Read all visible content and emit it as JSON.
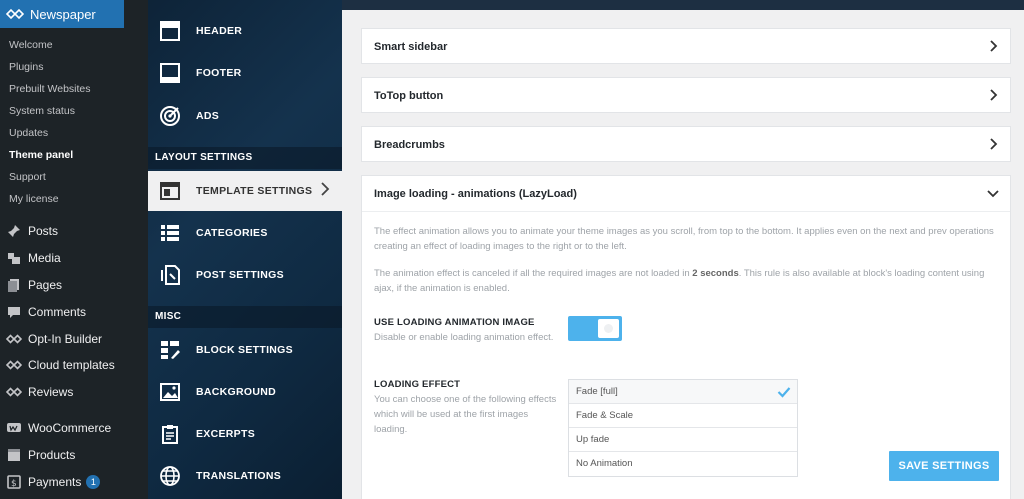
{
  "wp_menu": {
    "brand": "Newspaper",
    "submenu": [
      {
        "label": "Welcome",
        "current": false
      },
      {
        "label": "Plugins",
        "current": false
      },
      {
        "label": "Prebuilt Websites",
        "current": false
      },
      {
        "label": "System status",
        "current": false
      },
      {
        "label": "Updates",
        "current": false
      },
      {
        "label": "Theme panel",
        "current": true
      },
      {
        "label": "Support",
        "current": false
      },
      {
        "label": "My license",
        "current": false
      }
    ],
    "items": [
      {
        "label": "Posts",
        "icon": "pin-icon"
      },
      {
        "label": "Media",
        "icon": "media-icon"
      },
      {
        "label": "Pages",
        "icon": "pages-icon"
      },
      {
        "label": "Comments",
        "icon": "comments-icon"
      },
      {
        "label": "Opt-In Builder",
        "icon": "tagdiv-icon"
      },
      {
        "label": "Cloud templates",
        "icon": "tagdiv-icon"
      },
      {
        "label": "Reviews",
        "icon": "tagdiv-icon"
      },
      {
        "label": "WooCommerce",
        "icon": "woocommerce-icon"
      },
      {
        "label": "Products",
        "icon": "products-icon"
      },
      {
        "label": "Payments",
        "icon": "payments-icon",
        "badge": "1"
      }
    ]
  },
  "panel_nav": {
    "header": "HEADER",
    "footer": "FOOTER",
    "ads": "ADS",
    "layout_section": "LAYOUT SETTINGS",
    "template_settings": "TEMPLATE SETTINGS",
    "categories": "CATEGORIES",
    "post_settings": "POST SETTINGS",
    "misc_section": "MISC",
    "block_settings": "BLOCK SETTINGS",
    "background": "BACKGROUND",
    "excerpts": "EXCERPTS",
    "translations": "TRANSLATIONS"
  },
  "content": {
    "smart_sidebar": "Smart sidebar",
    "totop": "ToTop button",
    "breadcrumbs": "Breadcrumbs",
    "lazyload": {
      "title": "Image loading - animations (LazyLoad)",
      "desc1": "The effect animation allows you to animate your theme images as you scroll, from top to the bottom. It applies even on the next and prev operations creating an effect of loading images to the right or to the left.",
      "desc2_before": "The animation effect is canceled if all the required images are not loaded in ",
      "desc2_bold": "2 seconds",
      "desc2_after": ". This rule is also available at block's loading content using ajax, if the animation is enabled.",
      "use_anim_title": "USE LOADING ANIMATION IMAGE",
      "use_anim_desc": "Disable or enable loading animation effect.",
      "toggle_on": true,
      "effect_title": "LOADING EFFECT",
      "effect_desc": "You can choose one of the following effects which will be used at the first images loading.",
      "effects": [
        "Fade [full]",
        "Fade & Scale",
        "Up fade",
        "No Animation"
      ],
      "selected_effect": "Fade [full]",
      "save_label": "SAVE SETTINGS"
    }
  },
  "colors": {
    "wp_blue": "#2271b1",
    "accent": "#4db2ec",
    "wp_dark": "#1d2327"
  }
}
